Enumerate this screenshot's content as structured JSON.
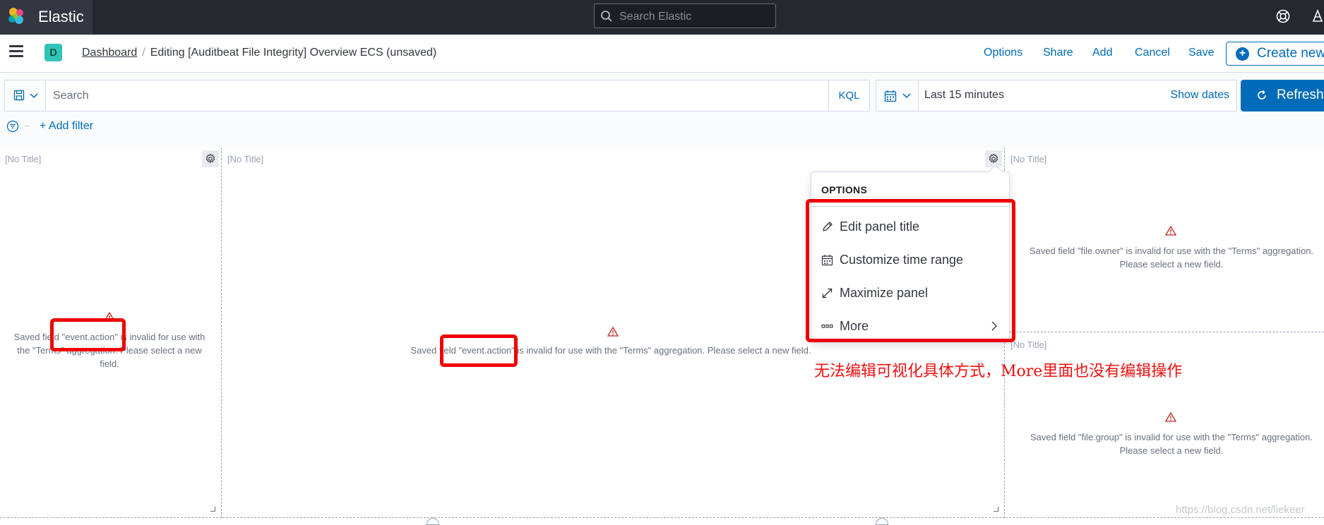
{
  "header": {
    "brand": "Elastic",
    "search_placeholder": "Search Elastic"
  },
  "subbar": {
    "space_initial": "D",
    "breadcrumb_root": "Dashboard",
    "breadcrumb_current": "Editing [Auditbeat File Integrity] Overview ECS (unsaved)",
    "nav": {
      "options": "Options",
      "share": "Share",
      "add": "Add",
      "cancel": "Cancel",
      "save": "Save",
      "create": "Create new"
    }
  },
  "query": {
    "placeholder": "Search",
    "language": "KQL",
    "time_range": "Last 15 minutes",
    "show_dates": "Show dates",
    "refresh": "Refresh",
    "add_filter": "+ Add filter"
  },
  "panels": {
    "no_title": "[No Title]",
    "left_msg_1": "Saved field \"event.action\" is invalid for use with",
    "left_msg_2": "the \"Terms\" aggregation. Please select a new",
    "left_msg_3": "field.",
    "center_msg": "Saved field \"event.action\" is invalid for use with the \"Terms\" aggregation. Please select a new field.",
    "right_top_msg_1": "Saved field \"file.owner\" is invalid for use with the \"Terms\" aggregation.",
    "right_top_msg_2": "Please select a new field.",
    "right_bottom_msg_1": "Saved field \"file.group\" is invalid for use with the \"Terms\" aggregation.",
    "right_bottom_msg_2": "Please select a new field."
  },
  "options_menu": {
    "header": "OPTIONS",
    "items": [
      {
        "label": "Edit panel title",
        "icon": "pencil-icon"
      },
      {
        "label": "Customize time range",
        "icon": "calendar-icon"
      },
      {
        "label": "Maximize panel",
        "icon": "expand-icon"
      },
      {
        "label": "More",
        "icon": "ellipsis-icon"
      }
    ]
  },
  "annotation": "无法编辑可视化具体方式，More里面也没有编辑操作",
  "watermark": "https://blog.csdn.net/liekeer",
  "colors": {
    "accent": "#006bb8",
    "topbar": "#25282f",
    "annotation_red": "#ee0000",
    "warning": "#bd271e"
  }
}
